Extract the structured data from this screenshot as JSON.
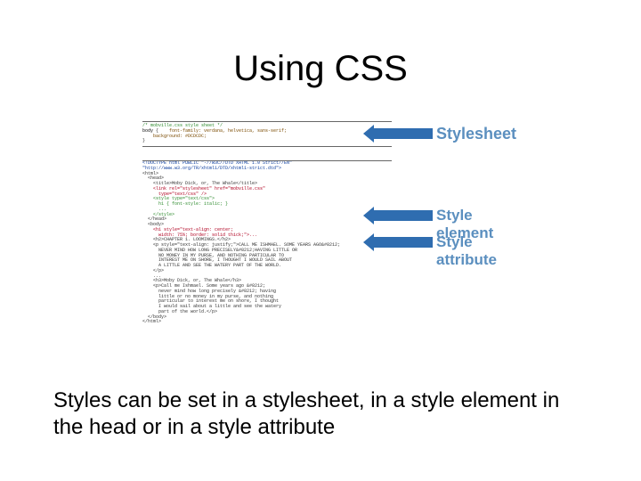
{
  "title": "Using CSS",
  "caption": "Styles can be set in a stylesheet, in a style element in the head or in a style attribute",
  "labels": {
    "stylesheet": "Stylesheet",
    "styleelement": "Style element",
    "styleattribute": "Style attribute"
  },
  "code": {
    "sheet_comment": "/* mobville.css style sheet */",
    "sheet_body_open": "body",
    "sheet_ff": "    font-family: verdana, helvetica, sans-serif;",
    "sheet_bg": "    background: #DCDCDC;",
    "sheet_close": "}",
    "doctype": "<!DOCTYPE html PUBLIC \"-//W3C//DTD XHTML 1.0 Strict//EN\"",
    "doctype2": "\"http://www.w3.org/TR/xhtml1/DTD/xhtml1-strict.dtd\">",
    "html_open": "<html>",
    "head_open": "  <head>",
    "title_line": "    <title>Moby Dick, or, The Whale</title>",
    "link_line": "    <link rel=\"stylesheet\" href=\"mobville.css\"",
    "link_type": "      type=\"text/css\" />",
    "style_open": "    <style type=\"text/css\">",
    "style_rule": "      h1 { font-style: italic; }",
    "style_etc": "      ...",
    "style_close": "    </style>",
    "head_close": "  </head>",
    "body_open": "  <body>",
    "h1_line": "    <h1 style=\"text-align: center;",
    "h1_line2": "      width: 75%; border: solid thick;\">...",
    "h2_line": "    <h2>CHAPTER 1. LOOMINGS.</h2>",
    "p_open": "    <p style=\"text-align: justify;\">CALL ME ISHMAEL. SOME YEARS AGO&#8212;",
    "p1": "      NEVER MIND HOW LONG PRECISELY&#8212;HAVING LITTLE OR",
    "p2": "      NO MONEY IN MY PURSE, AND NOTHING PARTICULAR TO",
    "p3": "      INTEREST ME ON SHORE, I THOUGHT I WOULD SAIL ABOUT",
    "p4": "      A LITTLE AND SEE THE WATERY PART OF THE WORLD.",
    "p_close": "    </p>",
    "etc2": "    ...",
    "h3_1": "    <h3>Moby Dick, or, The Whale</h3>",
    "p2_open": "    <p>Call me Ishmael. Some years ago &#8212;",
    "p2_1": "      never mind how long precisely &#8212; having",
    "p2_2": "      little or no money in my purse, and nothing",
    "p2_3": "      particular to interest me on shore, I thought",
    "p2_4": "      I would sail about a little and see the watery",
    "p2_5": "      part of the world.</p>",
    "body_close": "  </body>",
    "html_close": "</html>"
  }
}
